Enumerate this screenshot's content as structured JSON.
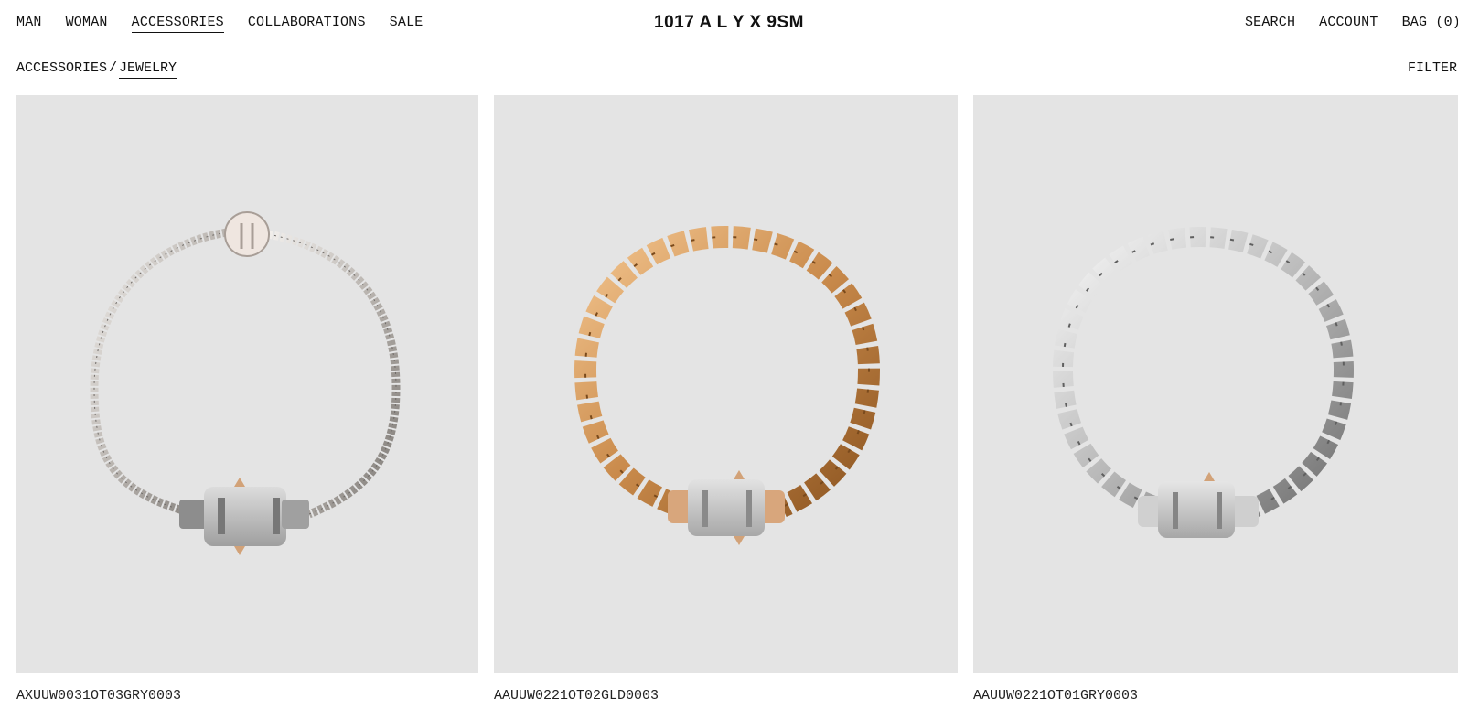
{
  "nav": {
    "left": [
      "MAN",
      "WOMAN",
      "ACCESSORIES",
      "COLLABORATIONS",
      "SALE"
    ],
    "active": "ACCESSORIES",
    "logo": "1017 A L Y X 9SM",
    "right": [
      "SEARCH",
      "ACCOUNT",
      "BAG (0)"
    ]
  },
  "breadcrumb": {
    "parent": "ACCESSORIES",
    "separator": "/",
    "current": "JEWELRY"
  },
  "filter_label": "FILTER",
  "products": [
    {
      "code": "AXUUW0031OT03GRY0003",
      "image": "silver-curb-chain-necklace-with-logo-pendant-and-buckle",
      "metal_color": "#c9c4c0"
    },
    {
      "code": "AAUUW0221OT02GLD0003",
      "image": "gold-curb-chain-necklace-with-buckle",
      "metal_color": "#c98a4b"
    },
    {
      "code": "AAUUW0221OT01GRY0003",
      "image": "silver-curb-chain-necklace-with-buckle",
      "metal_color": "#b9b9b9"
    }
  ],
  "colors": {
    "image_background": "#e4e4e4",
    "text": "#111111"
  }
}
